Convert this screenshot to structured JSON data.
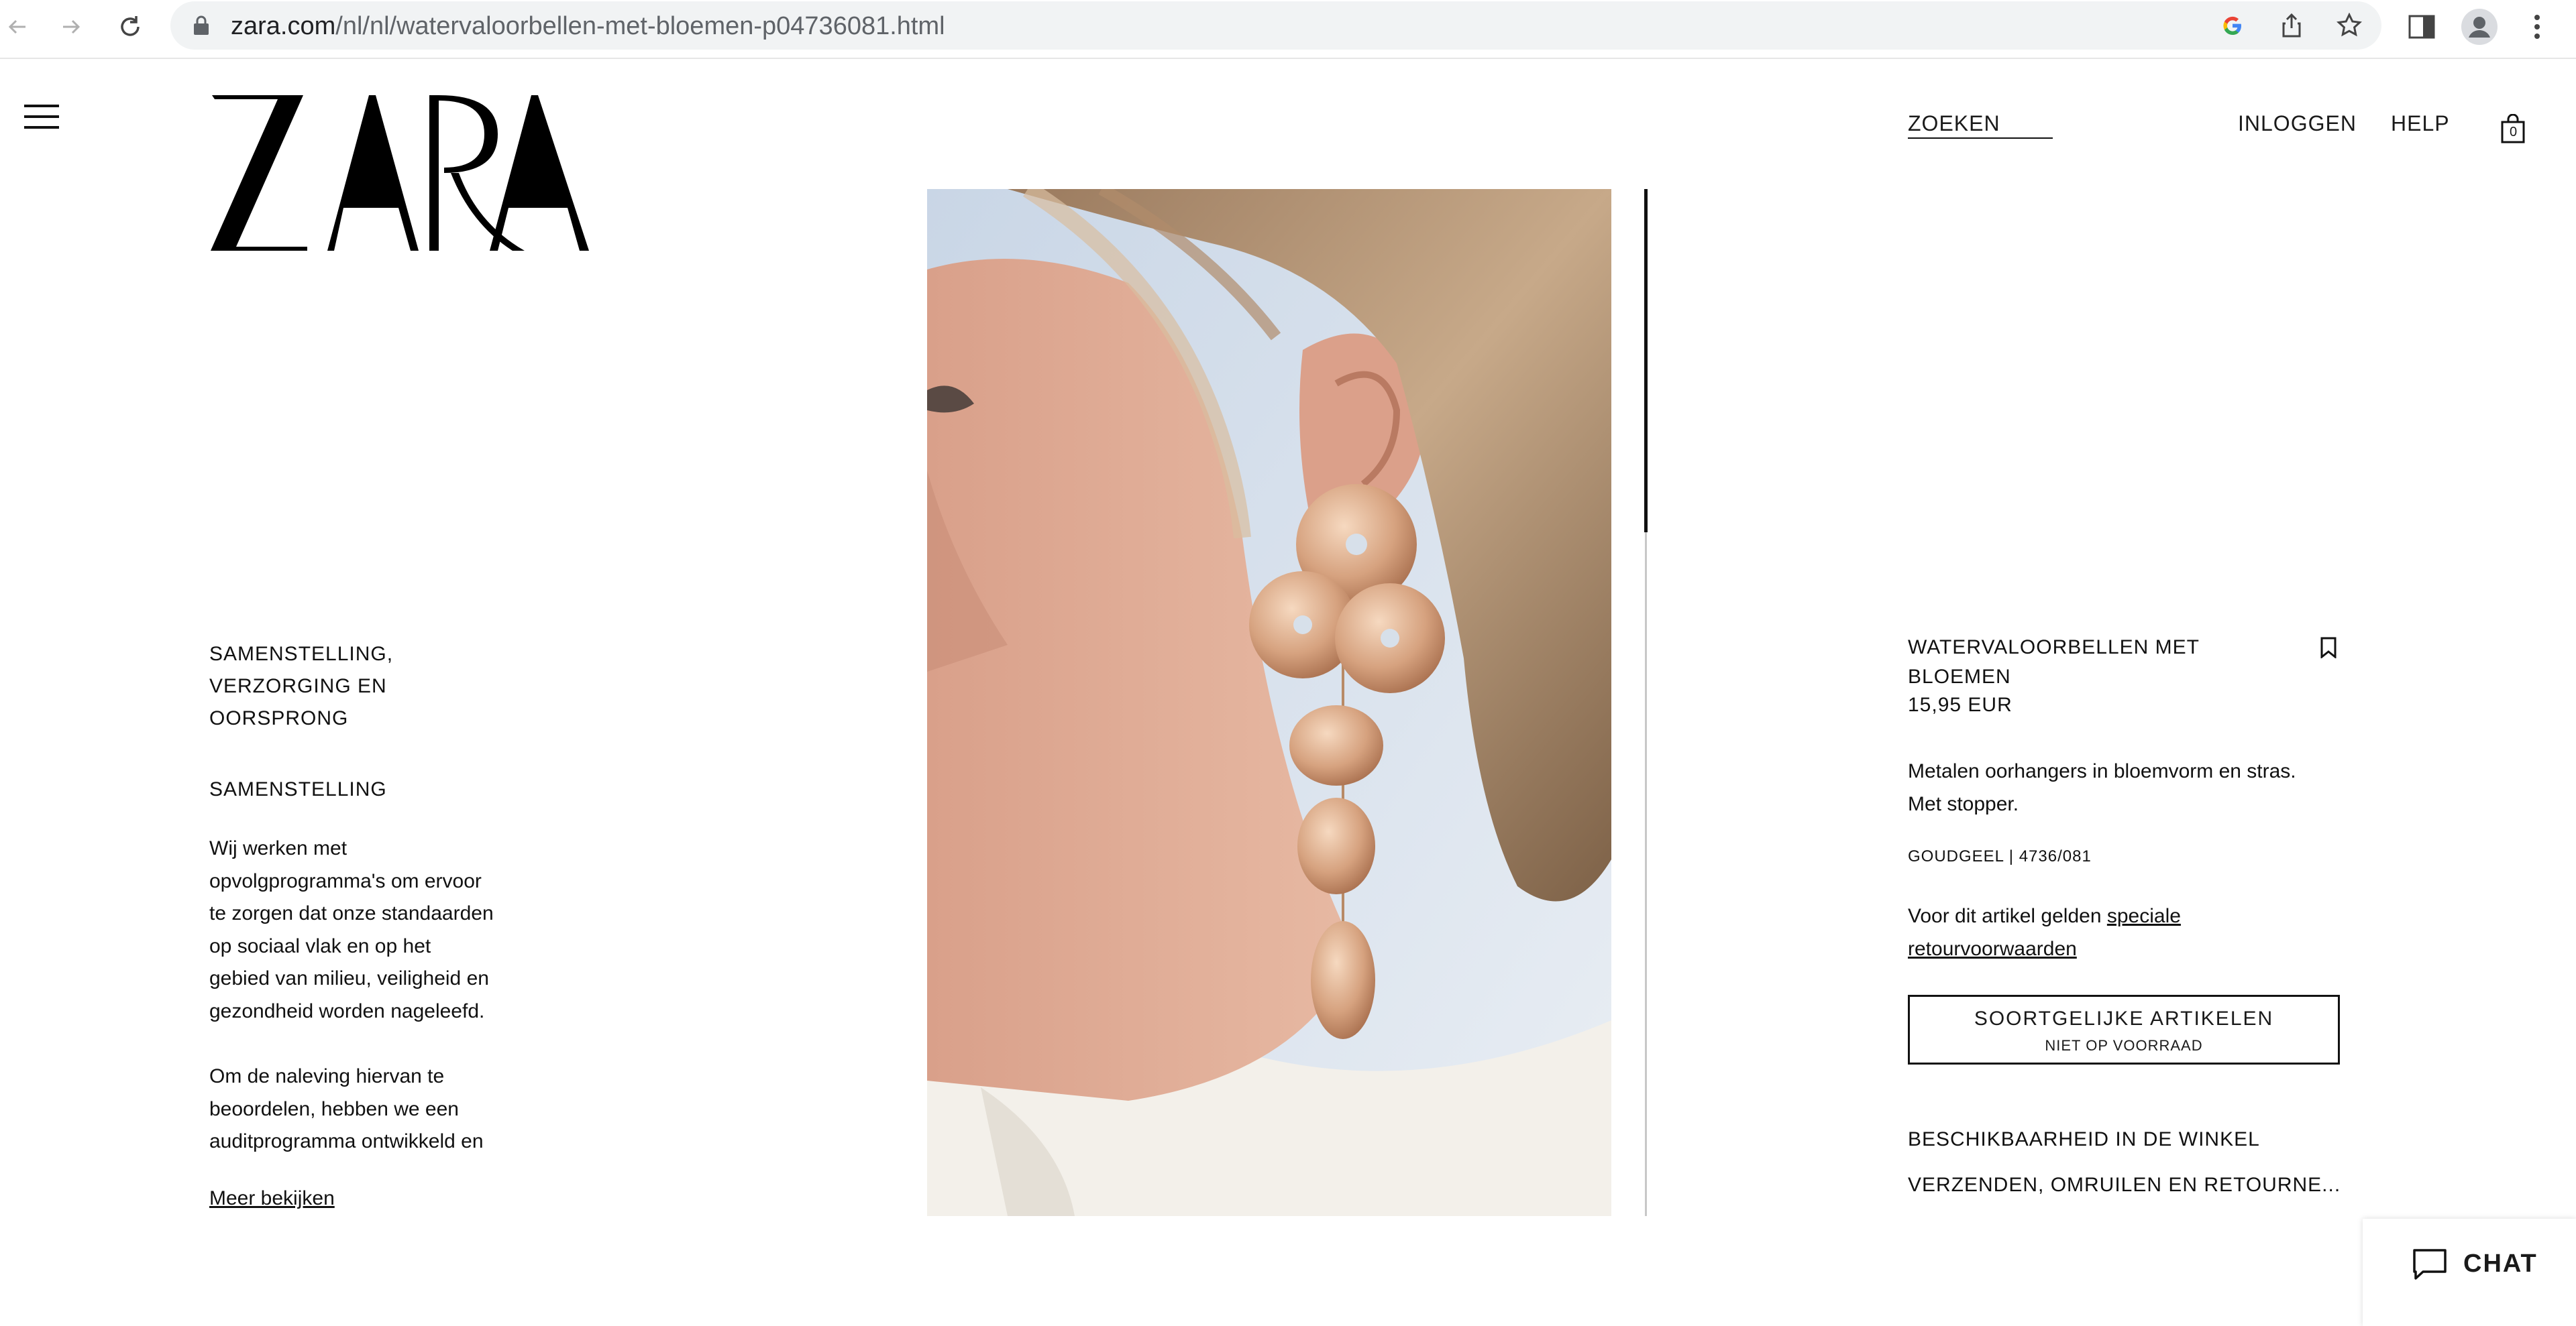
{
  "browser": {
    "url_host": "zara.com",
    "url_path": "/nl/nl/watervaloorbellen-met-bloemen-p04736081.html",
    "icons": [
      "back-icon",
      "forward-icon",
      "reload-icon",
      "lock-icon",
      "google-icon",
      "share-icon",
      "bookmark-star-icon",
      "sidebar-icon",
      "profile-icon",
      "menu-dots-icon"
    ]
  },
  "header": {
    "logo": "ZARA",
    "search_label": "ZOEKEN",
    "login_label": "INLOGGEN",
    "help_label": "HELP",
    "bag_count": "0"
  },
  "composition": {
    "heading_lines": [
      "SAMENSTELLING,",
      "VERZORGING EN",
      "OORSPRONG"
    ],
    "subheading": "SAMENSTELLING",
    "para1_lines": [
      "Wij werken met",
      "opvolgprogramma's om ervoor",
      "te zorgen dat onze standaarden",
      "op sociaal vlak en op het",
      "gebied van milieu, veiligheid en",
      "gezondheid worden nageleefd."
    ],
    "para2_lines": [
      "Om de naleving hiervan te",
      "beoordelen, hebben we een",
      "auditprogramma ontwikkeld en"
    ],
    "more_link": "Meer bekijken"
  },
  "product": {
    "name_lines": [
      "WATERVALOORBELLEN MET",
      "BLOEMEN"
    ],
    "price": "15,95 EUR",
    "description_lines": [
      "Metalen oorhangers in bloemvorm en stras.",
      "Met stopper."
    ],
    "color_ref": "GOUDGEEL | 4736/081",
    "return_text": "Voor dit artikel gelden ",
    "return_link_1": "speciale",
    "return_link_2": "retourvoorwaarden",
    "similar_button": "SOORTGELIJKE ARTIKELEN",
    "stock_status": "NIET OP VOORRAAD",
    "store_availability": "BESCHIKBAARHEID IN DE WINKEL",
    "shipping": "VERZENDEN, OMRUILEN EN RETOURNE..."
  },
  "chat": {
    "label": "CHAT"
  }
}
